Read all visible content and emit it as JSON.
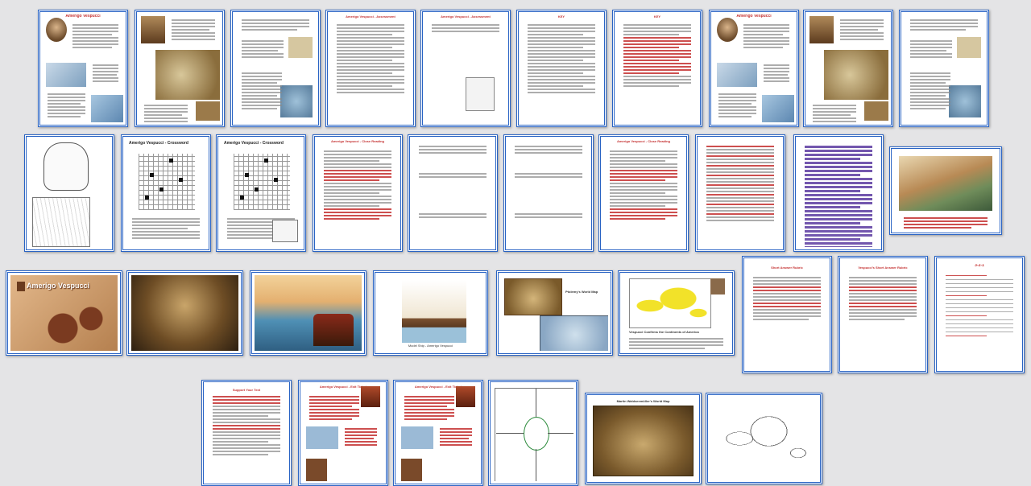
{
  "slides": [
    {
      "id": "s1",
      "title": "Amerigo Vespucci",
      "accent": "#c43030",
      "kind": "portrait-text"
    },
    {
      "id": "s2",
      "title": "",
      "accent": "#555555",
      "kind": "text-maps"
    },
    {
      "id": "s3",
      "title": "",
      "accent": "#555555",
      "kind": "quote-text"
    },
    {
      "id": "s4",
      "title": "Amerigo Vespucci - Assessment",
      "accent": "#c43030",
      "kind": "questions"
    },
    {
      "id": "s5",
      "title": "Amerigo Vespucci - Assessment",
      "accent": "#c43030",
      "kind": "short-q"
    },
    {
      "id": "s6",
      "title": "KEY",
      "accent": "#c43030",
      "kind": "questions"
    },
    {
      "id": "s7",
      "title": "KEY",
      "accent": "#c43030",
      "kind": "red-text"
    },
    {
      "id": "s8",
      "title": "Amerigo Vespucci",
      "accent": "#c43030",
      "kind": "portrait-text"
    },
    {
      "id": "s9",
      "title": "",
      "accent": "#555555",
      "kind": "text-maps"
    },
    {
      "id": "s10",
      "title": "",
      "accent": "#555555",
      "kind": "quote-text"
    },
    {
      "id": "s11",
      "title": "",
      "accent": "#555555",
      "kind": "sketch"
    },
    {
      "id": "s12",
      "title": "Amerigo Vespucci - Crossword",
      "accent": "#222222",
      "kind": "crossword"
    },
    {
      "id": "s13",
      "title": "Amerigo Vespucci - Crossword",
      "accent": "#222222",
      "kind": "crossword2"
    },
    {
      "id": "s14",
      "title": "Amerigo Vespucci - Close Reading",
      "accent": "#c43030",
      "kind": "reading"
    },
    {
      "id": "s15",
      "title": "",
      "accent": "#555555",
      "kind": "reading-plain"
    },
    {
      "id": "s16",
      "title": "",
      "accent": "#555555",
      "kind": "reading-plain"
    },
    {
      "id": "s17",
      "title": "Amerigo Vespucci - Close Reading",
      "accent": "#c43030",
      "kind": "reading"
    },
    {
      "id": "s18",
      "title": "",
      "accent": "#c43030",
      "kind": "annotated"
    },
    {
      "id": "s19",
      "title": "",
      "accent": "#5a3aa0",
      "kind": "purple"
    },
    {
      "id": "s20",
      "title": "",
      "accent": "#555555",
      "kind": "painting"
    },
    {
      "id": "s21",
      "title": "Amerigo Vespucci",
      "accent": "#c43030",
      "kind": "title-map"
    },
    {
      "id": "s22",
      "title": "",
      "accent": "#555555",
      "kind": "painting-dark"
    },
    {
      "id": "s23",
      "title": "",
      "accent": "#555555",
      "kind": "painting-sea"
    },
    {
      "id": "s24",
      "title": "",
      "accent": "#555555",
      "kind": "ship"
    },
    {
      "id": "s25",
      "title": "Ptolemy's World Map",
      "accent": "#222222",
      "kind": "two-maps"
    },
    {
      "id": "s26",
      "title": "Vespucci Confirms the Continents of America",
      "accent": "#222222",
      "kind": "yellow-map"
    },
    {
      "id": "s27",
      "title": "Short Answer Rubric",
      "accent": "#c43030",
      "kind": "rubric"
    },
    {
      "id": "s28",
      "title": "Vespucci's Short Answer Rubric",
      "accent": "#c43030",
      "kind": "rubric2"
    },
    {
      "id": "s29",
      "title": "3-2-1",
      "accent": "#c43030",
      "kind": "321"
    },
    {
      "id": "s30",
      "title": "Support Your Text",
      "accent": "#c43030",
      "kind": "support"
    },
    {
      "id": "s31",
      "title": "Amerigo Vespucci - Exit Ticket",
      "accent": "#c43030",
      "kind": "exit"
    },
    {
      "id": "s32",
      "title": "Amerigo Vespucci - Exit Ticket",
      "accent": "#c43030",
      "kind": "exit"
    },
    {
      "id": "s33",
      "title": "",
      "accent": "#555555",
      "kind": "mindmap"
    },
    {
      "id": "s34",
      "title": "Martin Waldseemüller's World Map",
      "accent": "#222222",
      "kind": "old-map"
    },
    {
      "id": "s35",
      "title": "",
      "accent": "#555555",
      "kind": "blank-map"
    }
  ],
  "labels": {
    "crossword": "Amerigo Vespucci - Crossword",
    "ptolemy": "Ptolemy's World Map",
    "vespucci_confirms": "Vespucci Confirms the Continents of America",
    "waldseemuller": "Martin Waldseemüller's World Map",
    "rubric": "Short Answer Rubric",
    "rubric2": "Vespucci's Short Answer Rubric",
    "three21": "3-2-1",
    "support": "Support Your Text",
    "title_slide": "Amerigo Vespucci",
    "ship_caption": "Model Ship - Amerigo Vespucci"
  }
}
